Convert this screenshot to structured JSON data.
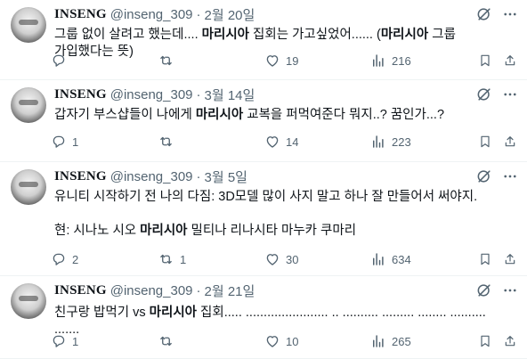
{
  "tweets": [
    {
      "name": "INSENG",
      "handle": "@inseng_309",
      "separator": "·",
      "date": "2월 20일",
      "text_segments": [
        {
          "text": "그룹 없이 살려고 했는데.... ",
          "bold": false
        },
        {
          "text": "마리시아",
          "bold": true
        },
        {
          "text": " 집회는 가고싶었어...... (",
          "bold": false
        },
        {
          "text": "마리시아",
          "bold": true
        },
        {
          "text": " 그룹 가입했다는 뜻)",
          "bold": false
        }
      ],
      "replies": "",
      "retweets": "",
      "likes": "19",
      "views": "216"
    },
    {
      "name": "INSENG",
      "handle": "@inseng_309",
      "separator": "·",
      "date": "3월 14일",
      "text_segments": [
        {
          "text": "갑자기 부스샵들이 나에게 ",
          "bold": false
        },
        {
          "text": "마리시아",
          "bold": true
        },
        {
          "text": " 교복을 퍼먹여준다 뭐지..? 꿈인가...?",
          "bold": false
        }
      ],
      "replies": "1",
      "retweets": "",
      "likes": "14",
      "views": "223"
    },
    {
      "name": "INSENG",
      "handle": "@inseng_309",
      "separator": "·",
      "date": "3월 5일",
      "text_segments": [
        {
          "text": "유니티 시작하기 전 나의 다짐: 3D모델 많이 사지 말고 하나 잘 만들어서 써야지.\n\n현: 시나노 시오 ",
          "bold": false
        },
        {
          "text": "마리시아",
          "bold": true
        },
        {
          "text": " 밀티나 리나시타 마누카 쿠마리",
          "bold": false
        }
      ],
      "replies": "2",
      "retweets": "1",
      "likes": "30",
      "views": "634"
    },
    {
      "name": "INSENG",
      "handle": "@inseng_309",
      "separator": "·",
      "date": "2월 21일",
      "text_segments": [
        {
          "text": "친구랑 밥먹기 vs ",
          "bold": false
        },
        {
          "text": "마리시아",
          "bold": true
        },
        {
          "text": " 집회..... ....................... .. .......... ......... ........ .......... .......",
          "bold": false
        }
      ],
      "replies": "1",
      "retweets": "",
      "likes": "10",
      "views": "265"
    }
  ]
}
